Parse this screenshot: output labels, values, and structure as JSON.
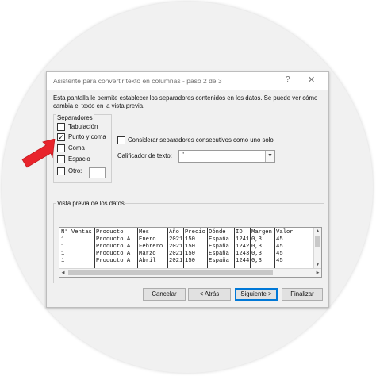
{
  "dialog": {
    "title": "Asistente para convertir texto en columnas - paso 2 de 3",
    "help": "?",
    "close": "✕",
    "description": "Esta pantalla le permite establecer los separadores contenidos en los datos. Se puede ver cómo cambia el texto en la vista previa."
  },
  "separators": {
    "legend": "Separadores",
    "tab": {
      "label": "Tabulación",
      "checked": false
    },
    "semicolon": {
      "label": "Punto y coma",
      "checked": true
    },
    "comma": {
      "label": "Coma",
      "checked": false
    },
    "space": {
      "label": "Espacio",
      "checked": false
    },
    "other": {
      "label": "Otro:",
      "checked": false,
      "value": ""
    }
  },
  "consecutive": {
    "label": "Considerar separadores consecutivos como uno solo",
    "checked": false
  },
  "qualifier": {
    "label": "Calificador de texto:",
    "value": "\""
  },
  "preview": {
    "legend": "Vista previa de los datos",
    "columns": [
      [
        "N° Ventas",
        "1",
        "1",
        "1",
        "1"
      ],
      [
        "Producto",
        "Producto A",
        "Producto A",
        "Producto A",
        "Producto A"
      ],
      [
        "Mes",
        "Enero",
        "Febrero",
        "Marzo",
        "Abril"
      ],
      [
        "Año",
        "2021",
        "2021",
        "2021",
        "2021"
      ],
      [
        "Precio",
        "150",
        "150",
        "150",
        "150"
      ],
      [
        "Dónde",
        "España",
        "España",
        "España",
        "España"
      ],
      [
        "ID",
        "1241",
        "1242",
        "1243",
        "1244"
      ],
      [
        "Margen",
        "0,3",
        "0,3",
        "0,3",
        "0,3"
      ],
      [
        "Valor",
        "45",
        "45",
        "45",
        "45"
      ]
    ]
  },
  "buttons": {
    "cancel": "Cancelar",
    "back": "< Atrás",
    "next": "Siguiente >",
    "finish": "Finalizar"
  },
  "colors": {
    "pointer_arrow": "#e8242c",
    "dialog_bg": "#f0f0f0",
    "default_button_border": "#0078d7"
  }
}
